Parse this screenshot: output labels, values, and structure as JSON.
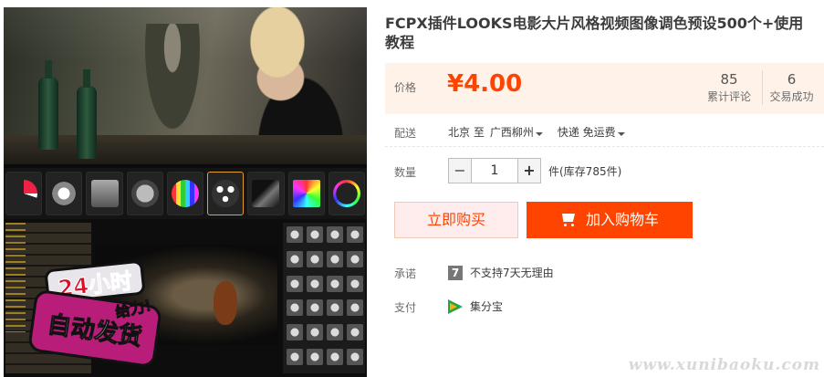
{
  "product": {
    "title": "FCPX插件LOOKS电影大片风格视频图像调色预设500个+使用教程"
  },
  "image": {
    "promo_top": "24小时",
    "promo_bottom": "自动发货",
    "promo_side": "给力！"
  },
  "price": {
    "label": "价格",
    "value": "¥4.00"
  },
  "stats": {
    "reviews_count": "85",
    "reviews_label": "累计评论",
    "deals_count": "6",
    "deals_label": "交易成功"
  },
  "shipping": {
    "label": "配送",
    "from": "北京 至",
    "to": "广西柳州",
    "method": "快递 免运费"
  },
  "quantity": {
    "label": "数量",
    "minus": "−",
    "value": "1",
    "plus": "+",
    "stock": "件(库存785件)"
  },
  "actions": {
    "buy_now": "立即购买",
    "add_to_cart": "加入购物车"
  },
  "promise": {
    "label": "承诺",
    "icon_text": "7",
    "text": "不支持7天无理由"
  },
  "payment": {
    "label": "支付",
    "method": "集分宝"
  },
  "watermark": "www.xunibaoku.com",
  "colors": {
    "accent": "#ff4400",
    "price_bg": "#fff2e8",
    "buy_bg": "#ffeded"
  }
}
